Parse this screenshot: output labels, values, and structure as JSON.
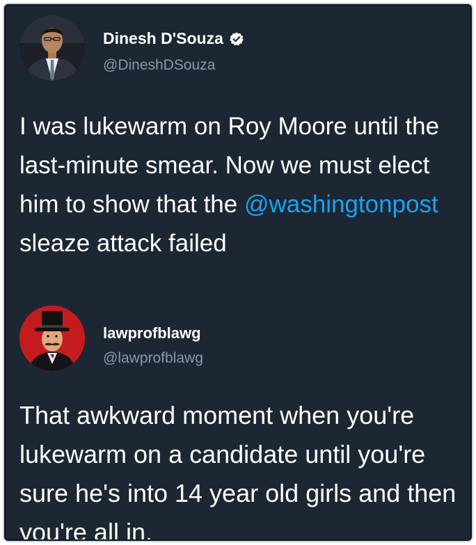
{
  "tweets": [
    {
      "display_name": "Dinesh D'Souza",
      "handle": "@DineshDSouza",
      "verified": true,
      "avatar": "person-in-suit-avatar",
      "text": {
        "before": "I was lukewarm on Roy Moore until the last-minute smear. Now we must elect him to show that the ",
        "mention": "@washingtonpost",
        "after": " sleaze attack failed"
      }
    },
    {
      "display_name": "lawprofblawg",
      "handle": "@lawprofblawg",
      "verified": false,
      "avatar": "top-hat-mustache-man-avatar",
      "text": {
        "before": "That awkward moment when you're lukewarm on a candidate until you're sure he's into 14 year old girls and then you're all in."
      }
    }
  ],
  "colors": {
    "background": "#1c2733",
    "text": "#ffffff",
    "handle": "#8899a6",
    "mention": "#1da1f2"
  },
  "icons": [
    "verified-badge-icon"
  ]
}
